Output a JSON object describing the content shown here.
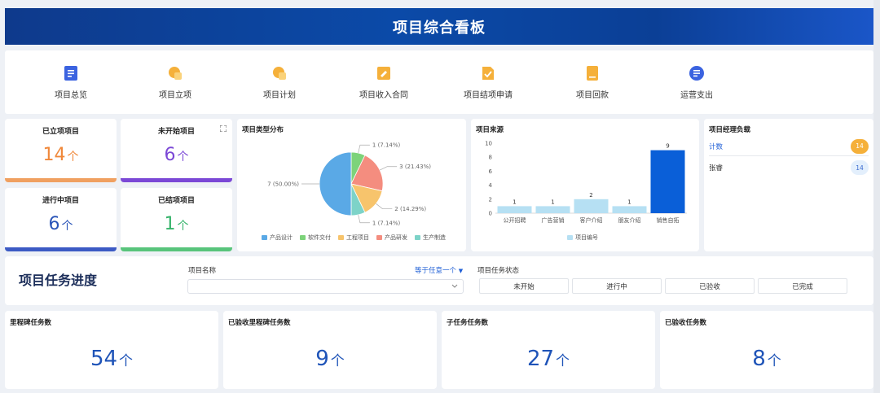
{
  "header": {
    "title": "项目综合看板"
  },
  "nav": [
    {
      "label": "项目总览",
      "icon": "list-icon",
      "color": "#3b63e0"
    },
    {
      "label": "项目立项",
      "icon": "circle-tag-icon",
      "color": "#f5b03a"
    },
    {
      "label": "项目计划",
      "icon": "circle-tag-icon",
      "color": "#f5b03a"
    },
    {
      "label": "项目收入合同",
      "icon": "edit-doc-icon",
      "color": "#f5b03a"
    },
    {
      "label": "项目结项申请",
      "icon": "check-doc-icon",
      "color": "#f5b03a"
    },
    {
      "label": "项目回款",
      "icon": "doc-icon",
      "color": "#f5b03a"
    },
    {
      "label": "运营支出",
      "icon": "list-circle-icon",
      "color": "#3b63e0"
    }
  ],
  "stats": [
    {
      "title": "已立项项目",
      "value": "14",
      "unit": "个",
      "color": "#f0883a",
      "bar": "#f0a060"
    },
    {
      "title": "未开始项目",
      "value": "6",
      "unit": "个",
      "color": "#7b48d6",
      "bar": "#7b48d6"
    },
    {
      "title": "进行中项目",
      "value": "6",
      "unit": "个",
      "color": "#2a55b8",
      "bar": "#3c5ac4"
    },
    {
      "title": "已结项项目",
      "value": "1",
      "unit": "个",
      "color": "#35b36a",
      "bar": "#58c47b"
    }
  ],
  "pie": {
    "title": "项目类型分布",
    "labels": [
      "1 (7.14%)",
      "3 (21.43%)",
      "2 (14.29%)",
      "1 (7.14%)",
      "7 (50.00%)"
    ]
  },
  "bar": {
    "title": "项目来源",
    "legend": "项目编号"
  },
  "chart_data": [
    {
      "type": "pie",
      "title": "项目类型分布",
      "categories": [
        "产品设计",
        "软件交付",
        "工程项目",
        "产品研发",
        "生产制造"
      ],
      "values": [
        7,
        1,
        2,
        3,
        1
      ],
      "percentages": [
        50.0,
        7.14,
        14.29,
        21.43,
        7.14
      ],
      "colors": [
        "#5aa9e6",
        "#7dd37a",
        "#f7c46c",
        "#f48d7f",
        "#7dd3c8"
      ],
      "legend": "bottom"
    },
    {
      "type": "bar",
      "title": "项目来源",
      "categories": [
        "公开招聘",
        "广告营销",
        "客户介绍",
        "朋友介绍",
        "销售自拓"
      ],
      "series": [
        {
          "name": "项目编号",
          "values": [
            1,
            1,
            2,
            1,
            9
          ],
          "colors": [
            "#b6e0f3",
            "#b6e0f3",
            "#b6e0f3",
            "#b6e0f3",
            "#0a5fd8"
          ]
        }
      ],
      "ylim": [
        0,
        10
      ],
      "yticks": [
        0,
        2,
        4,
        6,
        8,
        10
      ],
      "legend": "bottom"
    }
  ],
  "load": {
    "title": "项目经理负载",
    "rows": [
      {
        "name": "计数",
        "value": "14",
        "name_color": "#1f5fd6",
        "badge_bg": "#f5b03a",
        "badge_fg": "#ffffff"
      },
      {
        "name": "张睿",
        "value": "14",
        "name_color": "#333333",
        "badge_bg": "#e3effc",
        "badge_fg": "#3a6bd0"
      }
    ]
  },
  "task": {
    "title": "项目任务进度",
    "filter_label": "项目名称",
    "filter_link": "等于任意一个",
    "status_label": "项目任务状态",
    "statuses": [
      "未开始",
      "进行中",
      "已验收",
      "已完成"
    ]
  },
  "bottom": [
    {
      "title": "里程碑任务数",
      "value": "54",
      "unit": "个"
    },
    {
      "title": "已验收里程碑任务数",
      "value": "9",
      "unit": "个"
    },
    {
      "title": "子任务任务数",
      "value": "27",
      "unit": "个"
    },
    {
      "title": "已验收任务数",
      "value": "8",
      "unit": "个"
    }
  ]
}
